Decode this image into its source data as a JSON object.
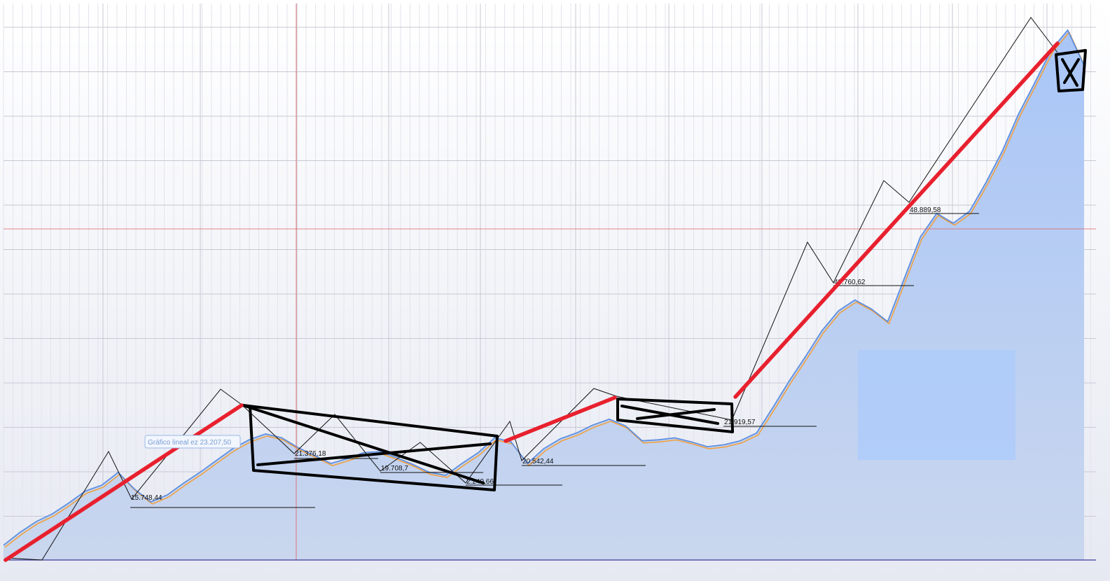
{
  "colors": {
    "area_fill": "#a9c6f7",
    "price_line": "#5f8fe0",
    "price_line_alt": "#f0a040",
    "trend_red": "#e8202e",
    "hand_drawn": "#000000",
    "crosshair": "#e06060",
    "grid_major": "#c8c8d4",
    "grid_minor": "#e4e4ec",
    "baseline": "#3a3a9a"
  },
  "tooltip": {
    "label": "Gráfico lineal ez",
    "value": "23.207,50"
  },
  "annotations": [
    {
      "text": "15.748,44"
    },
    {
      "text": "21.376,18"
    },
    {
      "text": "19.708,7"
    },
    {
      "text": "2.249,66"
    },
    {
      "text": "20.542,44"
    },
    {
      "text": "21.919,57"
    },
    {
      "text": "40.760,62"
    },
    {
      "text": "48.889,58"
    }
  ],
  "chart_data": {
    "type": "area",
    "title": "",
    "xlabel": "",
    "ylabel": "",
    "y_scale": "linear",
    "grid": true,
    "legend": "none",
    "series": [
      {
        "values": [
          13500,
          14800,
          15900,
          16700,
          17800,
          19000,
          19600,
          20900,
          19200,
          17900,
          18600,
          19800,
          20900,
          22100,
          23300,
          24200,
          24800,
          24400,
          23400,
          22600,
          21800,
          22300,
          22900,
          23000,
          22400,
          21700,
          20900,
          20600,
          21800,
          22900,
          24400,
          24000,
          21800,
          23300,
          24300,
          24900,
          25700,
          26300,
          25600,
          24100,
          24200,
          24400,
          24000,
          23500,
          23700,
          24100,
          24900,
          27500,
          30200,
          32700,
          35300,
          37300,
          38400,
          37500,
          36200,
          40500,
          44800,
          47200,
          46200,
          47400,
          50300,
          53500,
          57300,
          60500,
          63800,
          65800,
          62200
        ]
      }
    ],
    "swing_levels": [
      "15.748,44",
      "21.376,18",
      "19.708,7",
      "2.249,66",
      "20.542,44",
      "21.919,57",
      "40.760,62",
      "48.889,58"
    ]
  }
}
